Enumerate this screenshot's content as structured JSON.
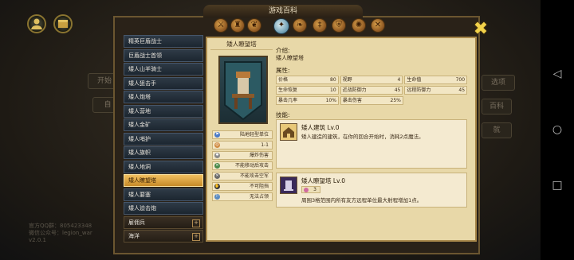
{
  "window": {
    "title": "游戏百科"
  },
  "tabs": [
    {
      "icon": "sword-icon",
      "glyph": "⚔"
    },
    {
      "icon": "helmet-icon",
      "glyph": "♜"
    },
    {
      "icon": "dragon-icon",
      "glyph": "❦"
    },
    {
      "icon": "compass-icon",
      "glyph": "✦",
      "active": true
    },
    {
      "icon": "vine-icon",
      "glyph": "❧"
    },
    {
      "icon": "staff-icon",
      "glyph": "‡"
    },
    {
      "icon": "shield-icon",
      "glyph": "⛨"
    },
    {
      "icon": "sun-icon",
      "glyph": "✺"
    },
    {
      "icon": "swords-icon",
      "glyph": "✕"
    }
  ],
  "sidebar": {
    "items": [
      {
        "label": "精英巨盾战士"
      },
      {
        "label": "巨盾战士首领"
      },
      {
        "label": "矮人山羊骑士"
      },
      {
        "label": "矮人狙击手"
      },
      {
        "label": "矮人炮塔"
      },
      {
        "label": "矮人营地"
      },
      {
        "label": "矮人金矿"
      },
      {
        "label": "矮人哨护"
      },
      {
        "label": "矮人旗帜"
      },
      {
        "label": "矮人地洞"
      },
      {
        "label": "矮人瞭望塔",
        "active": true
      },
      {
        "label": "矮人要塞"
      },
      {
        "label": "矮人迫击炮"
      },
      {
        "label": "雇佣兵",
        "group": true,
        "expand": "+"
      },
      {
        "label": "海洋",
        "group": true,
        "expand": "+"
      }
    ]
  },
  "unit": {
    "name": "矮人瞭望塔",
    "attributes": [
      {
        "icon": "unit-type-icon",
        "color": "#4a7ac8",
        "text": "陆地轻型单位"
      },
      {
        "icon": "range-icon",
        "color": "#d08a40",
        "text": "1-1"
      },
      {
        "icon": "damage-icon",
        "color": "#8a8a8a",
        "text": "爆炸伤害"
      },
      {
        "icon": "no-move-attack-icon",
        "color": "#4a8a4a",
        "text": "不能移动后攻击"
      },
      {
        "icon": "no-air-attack-icon",
        "color": "#6a6a6a",
        "text": "不能攻击空军"
      },
      {
        "icon": "no-retaliate-icon",
        "color": "#3a3a3a",
        "text": "不可阻挡"
      },
      {
        "icon": "no-capture-icon",
        "color": "#5a8ac0",
        "text": "无法占领"
      }
    ]
  },
  "info": {
    "intro_label": "介绍:",
    "intro_text": "矮人瞭望塔",
    "attr_label": "属性:",
    "stats": [
      [
        {
          "k": "价格",
          "v": "80"
        },
        {
          "k": "视野",
          "v": "4"
        },
        {
          "k": "生命值",
          "v": "700"
        }
      ],
      [
        {
          "k": "生命恢复",
          "v": "10"
        },
        {
          "k": "近战防御力",
          "v": "45"
        },
        {
          "k": "远程防御力",
          "v": "45"
        }
      ],
      [
        {
          "k": "暴击几率",
          "v": "10%"
        },
        {
          "k": "暴击伤害",
          "v": "25%"
        }
      ]
    ],
    "skill_label": "技能:",
    "skills": [
      {
        "icon": "dwarf-building-icon",
        "title": "矮人建筑 Lv.0",
        "desc": "矮人建造的建筑，在你的回合开始时，消耗2点魔法。"
      },
      {
        "icon": "watchtower-skill-icon",
        "title": "矮人瞭望塔 Lv.0",
        "mana": "3",
        "desc": "周围3格范围内所有友方远程单位最大射程增加1点。"
      }
    ]
  },
  "background": {
    "left_labels": [
      "开始",
      "自"
    ],
    "right_labels": [
      "选项",
      "百科",
      "就"
    ],
    "qq": [
      "官方QQ群：805423348",
      "微信公众号：legion_war",
      "v2.0.1"
    ]
  },
  "colors": {
    "accent": "#f0c060",
    "parchment": "#e8d8a8",
    "list_bg": "#1c2630"
  }
}
